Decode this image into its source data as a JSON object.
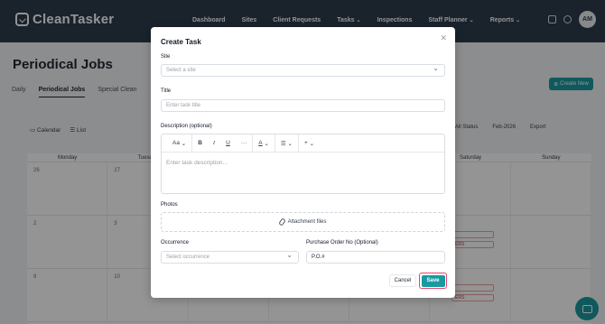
{
  "app": {
    "logo_text": "CleanTasker"
  },
  "nav": {
    "items": [
      {
        "label": "Dashboard",
        "has_dropdown": false
      },
      {
        "label": "Sites",
        "has_dropdown": false
      },
      {
        "label": "Client Requests",
        "has_dropdown": false
      },
      {
        "label": "Tasks",
        "has_dropdown": true
      },
      {
        "label": "Inspections",
        "has_dropdown": false
      },
      {
        "label": "Staff Planner",
        "has_dropdown": true
      },
      {
        "label": "Reports",
        "has_dropdown": true
      }
    ],
    "avatar_initials": "AM"
  },
  "page": {
    "title": "Periodical Jobs",
    "tabs": [
      "Daily",
      "Periodical Jobs",
      "Special Clean"
    ],
    "active_tab": "Periodical Jobs",
    "create_button": "Create New",
    "view_calendar": "Calendar",
    "view_list": "List",
    "status_filter": "All Status",
    "month": "Feb-2026",
    "export": "Export"
  },
  "calendar": {
    "headers": [
      "Monday",
      "Tuesday",
      "",
      "",
      "",
      "Saturday",
      "Sunday"
    ],
    "rows": [
      [
        "26",
        "27",
        "",
        "",
        "",
        "",
        ""
      ],
      [
        "2",
        "3",
        "",
        "",
        "",
        "",
        ""
      ],
      [
        "9",
        "10",
        "",
        "",
        "",
        "",
        ""
      ]
    ],
    "chips": [
      "",
      "ERS",
      "",
      "ERS"
    ]
  },
  "modal": {
    "title": "Create Task",
    "close_icon": "close-icon",
    "site_label": "Site",
    "site_placeholder": "Select a site",
    "title_label": "Title",
    "title_placeholder": "Enter task title",
    "description_label": "Description (optional)",
    "toolbar": {
      "font_size": "Aa",
      "bold": "B",
      "italic": "I",
      "underline": "U",
      "more": "···",
      "text_color": "A",
      "list": "☰",
      "insert": "+"
    },
    "description_placeholder": "Enter task description...",
    "photos_label": "Photos",
    "attach_label": "Attachment files",
    "occurrence_label": "Occurrence",
    "occurrence_placeholder": "Select occurrence",
    "po_label": "Purchase Order No (Optional)",
    "po_value": "P.O.#",
    "cancel_label": "Cancel",
    "save_label": "Save"
  },
  "colors": {
    "header_bg": "#2d3c4c",
    "accent": "#1a9aa0",
    "focus_ring": "#e0476b"
  }
}
